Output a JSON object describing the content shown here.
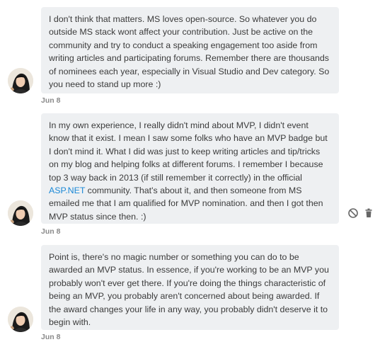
{
  "messages": [
    {
      "text": "I don't think that matters. MS loves open-source. So whatever you do outside MS stack wont affect your contribution. Just be active on the community and try to conduct a speaking engagement too aside from writing articles and  participating forums. Remember there are thousands of nominees each year, especially in Visual Studio and Dev category. So you need to stand up more :)",
      "date": "Jun 8"
    },
    {
      "text_before_link": "In my own experience, I really didn't mind about MVP, I didn't event know that it exist. I mean I saw some folks who have an MVP badge but I don't mind it. What I did was just to keep writing articles and tip/tricks on my blog and helping folks at different forums. I remember I because top 3 way back in 2013 (if still remember it correctly) in the official ",
      "link_text": "ASP.NET",
      "text_after_link": " community. That's about it, and then someone from MS emailed me that I am qualified for MVP nomination. and then I got then MVP status since then. :)",
      "date": "Jun 8",
      "actions": {
        "block_icon": "block-icon",
        "delete_icon": "trash-icon"
      }
    },
    {
      "text": "Point is, there's no magic number or something you can do to be awarded an MVP status. In essence, if you're working to be an MVP you probably won't ever get there. If you're doing the things characteristic of being an MVP, you probably aren't concerned about being awarded. If the award changes your life in any way, you probably didn't deserve it to begin with.",
      "date": "Jun 8"
    }
  ],
  "colors": {
    "bubble_bg": "#eef0f2",
    "link": "#1a88d6",
    "date": "#8a8a8a",
    "icon": "#666666"
  }
}
